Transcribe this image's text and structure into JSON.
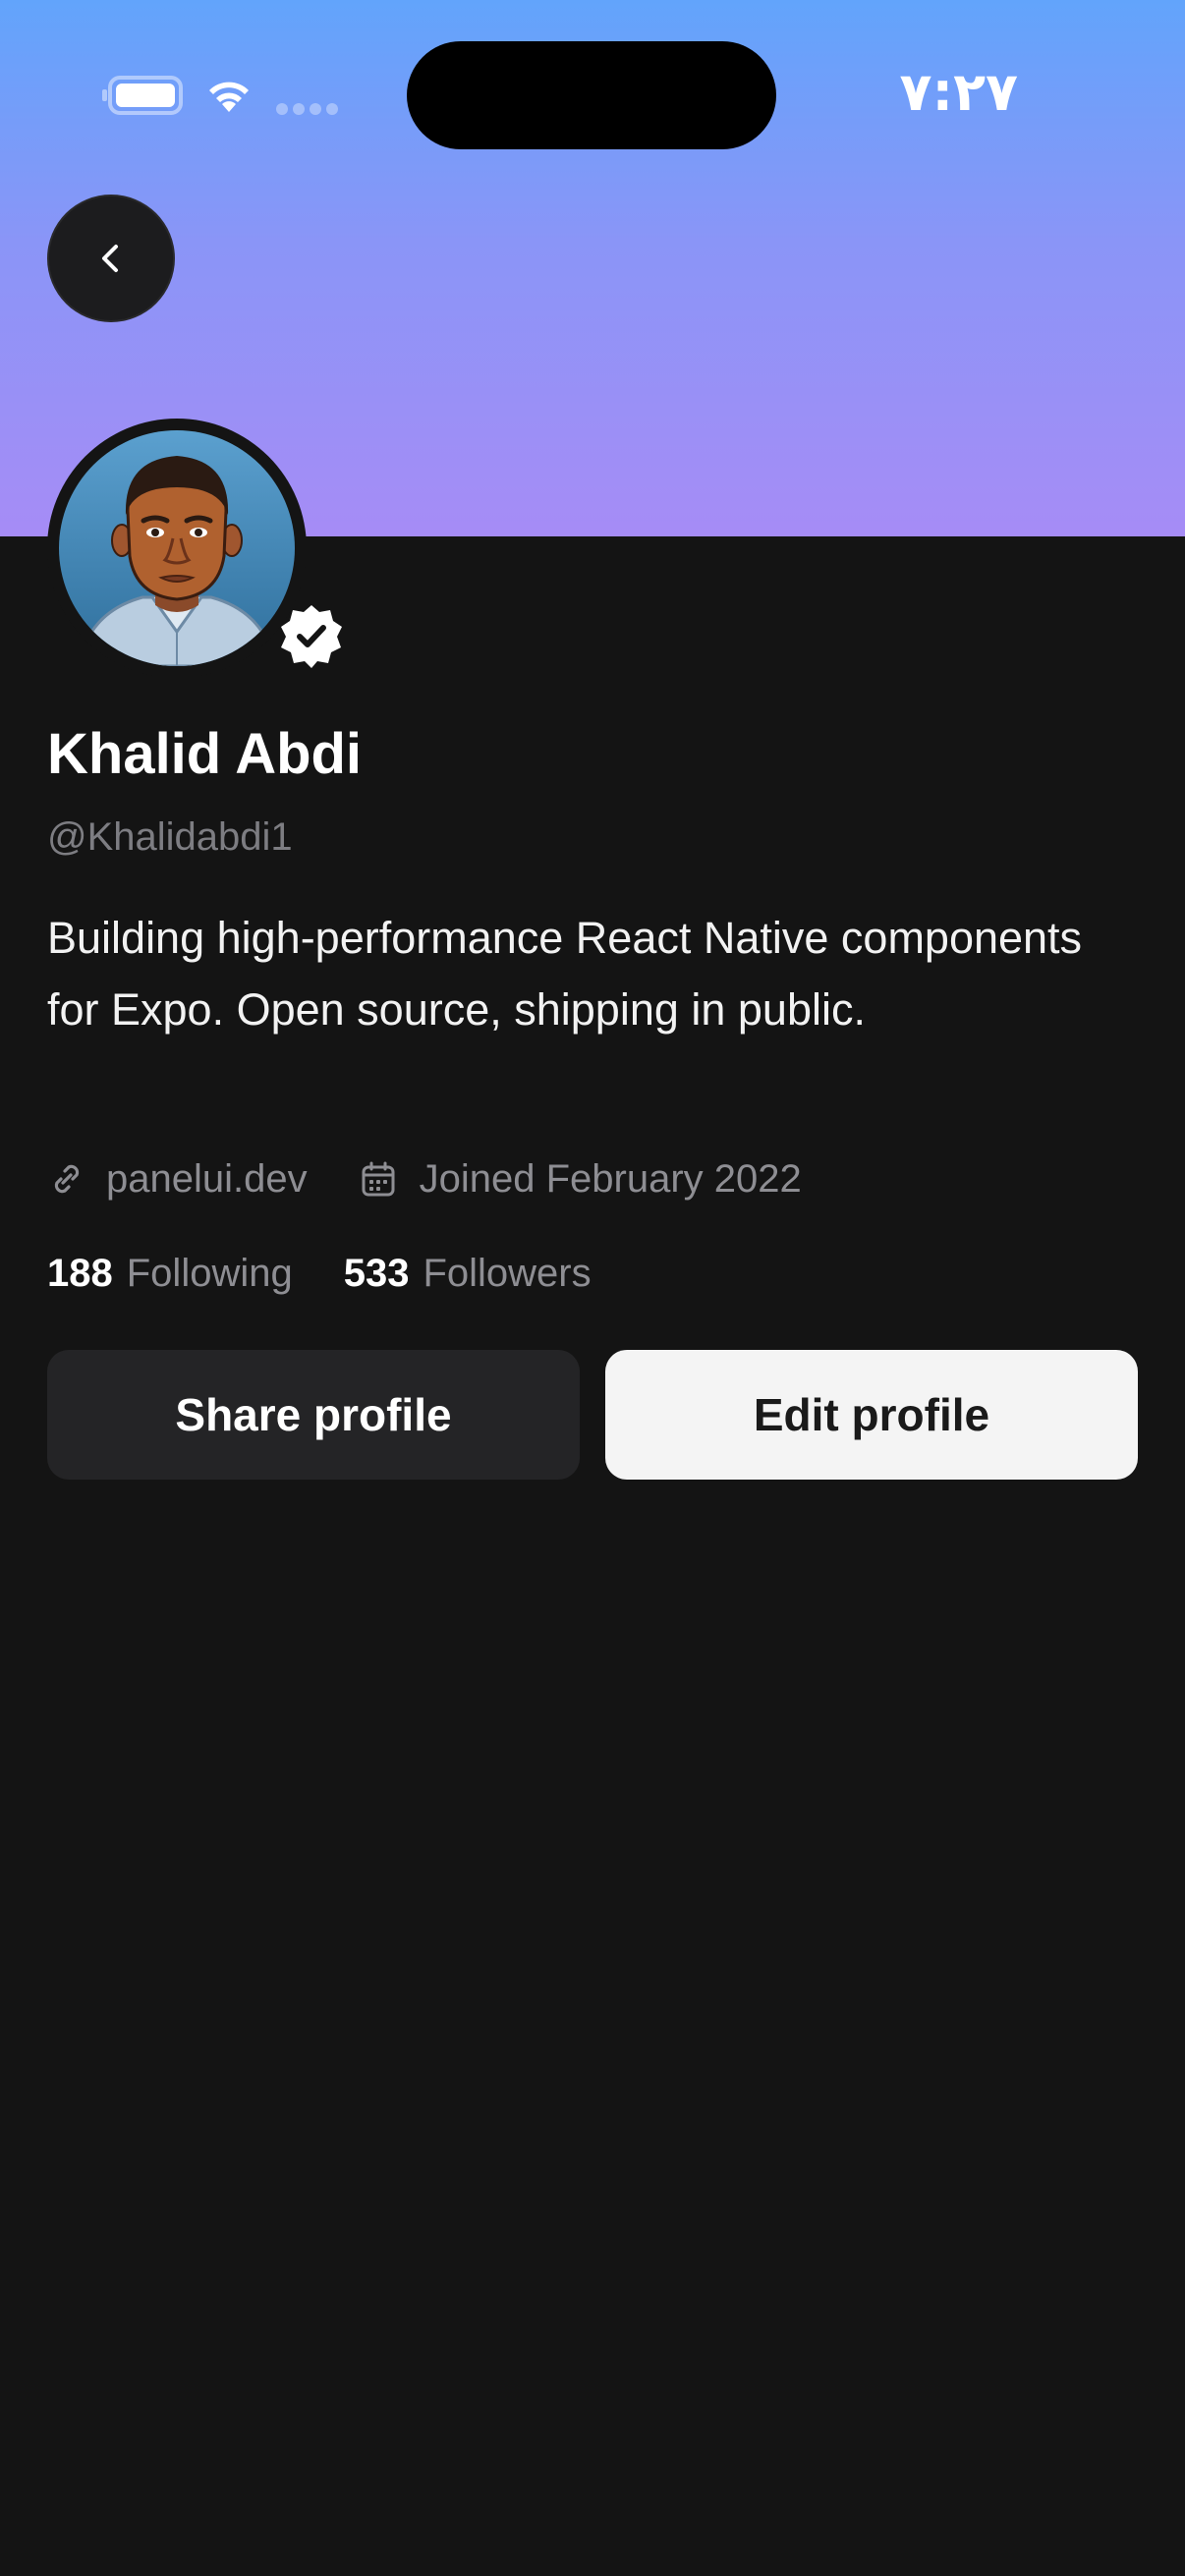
{
  "status_bar": {
    "time": "۷:۲۷",
    "battery_icon": "battery-icon",
    "wifi_icon": "wifi-icon",
    "signal_icon": "cellular-signal-icon"
  },
  "colors": {
    "banner_top": "#62a4fb",
    "banner_bottom": "#a68cf6",
    "background": "#141414",
    "verified": "#ffffff"
  },
  "header": {
    "back_icon": "chevron-left-icon"
  },
  "profile": {
    "avatar_icon": "avatar-illustration",
    "verified_icon": "verified-badge-icon",
    "name": "Khalid Abdi",
    "handle": "@Khalidabdi1",
    "bio": "Building high-performance React Native components for Expo. Open source, shipping in public.",
    "website_icon": "link-icon",
    "website": "panelui.dev",
    "joined_icon": "calendar-icon",
    "joined": "Joined February 2022",
    "following_count": "188",
    "following_label": "Following",
    "followers_count": "533",
    "followers_label": "Followers"
  },
  "actions": {
    "share_label": "Share profile",
    "edit_label": "Edit profile"
  }
}
